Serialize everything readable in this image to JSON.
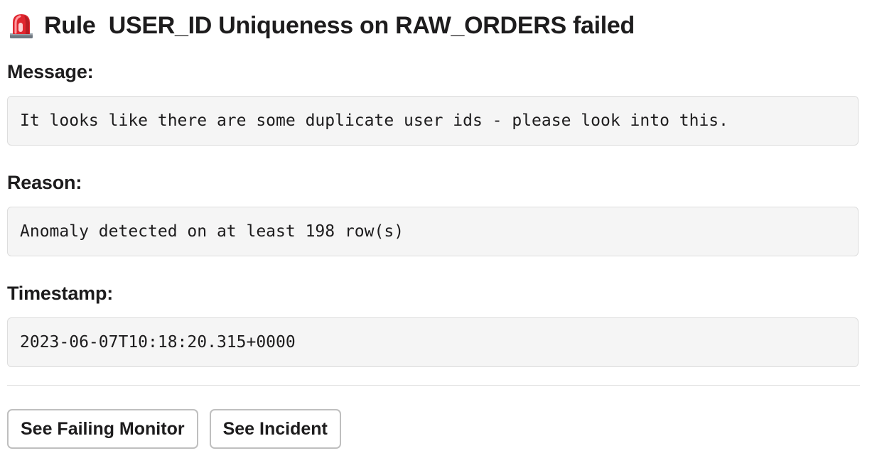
{
  "header": {
    "icon": "rotating-light-siren-icon",
    "title": "Rule  USER_ID Uniqueness on RAW_ORDERS failed"
  },
  "sections": {
    "message": {
      "label": "Message:",
      "value": "It looks like there are some duplicate user ids - please look into this."
    },
    "reason": {
      "label": "Reason:",
      "value": "Anomaly detected on at least 198 row(s)"
    },
    "timestamp": {
      "label": "Timestamp:",
      "value": "2023-06-07T10:18:20.315+0000"
    }
  },
  "actions": {
    "see_failing_monitor": "See Failing Monitor",
    "see_incident": "See Incident"
  },
  "colors": {
    "text": "#1d1c1d",
    "code_background": "#f5f5f5",
    "code_border": "#dddddd",
    "button_border": "#bfbfbf",
    "siren_red": "#e0262f"
  }
}
